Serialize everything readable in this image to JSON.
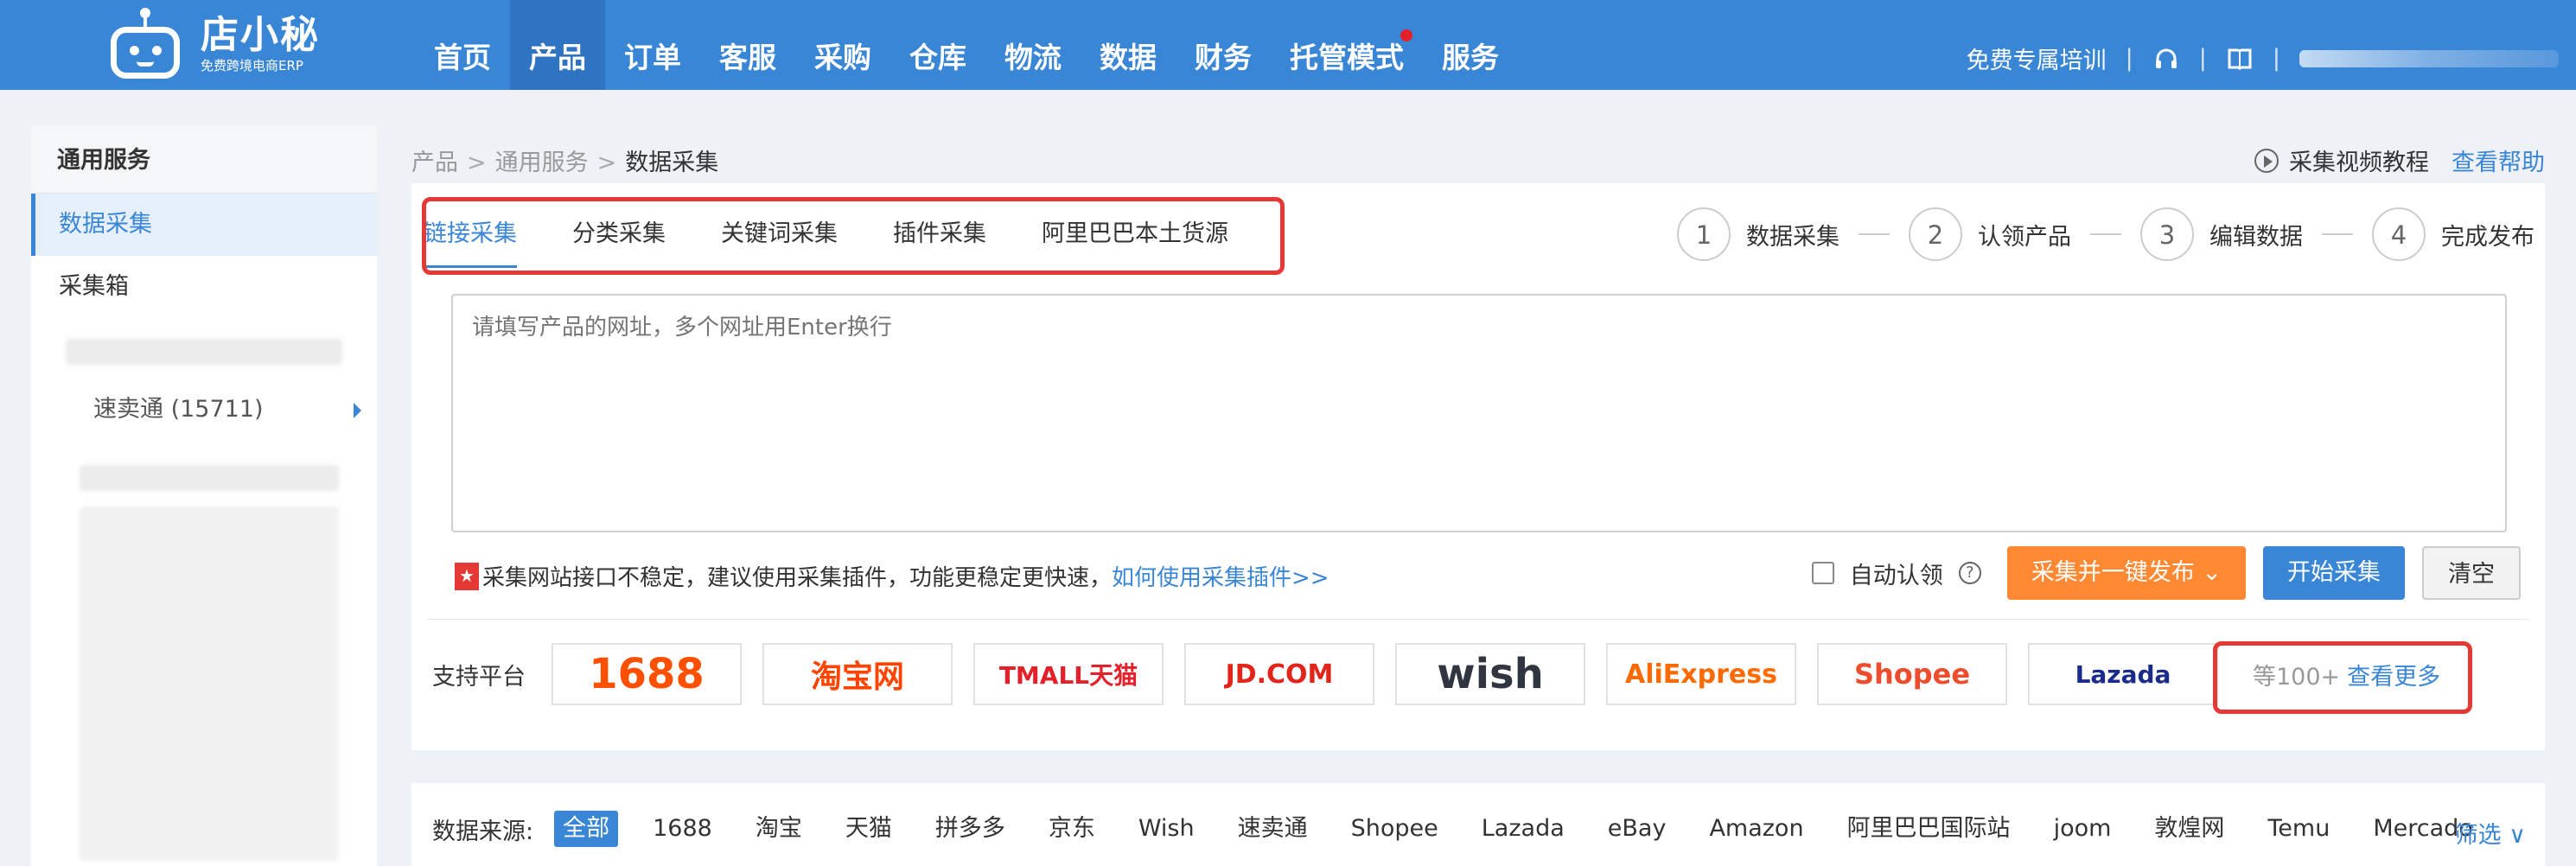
{
  "header": {
    "logo_name": "店小秘",
    "logo_sub": "免费跨境电商ERP",
    "nav": [
      {
        "label": "首页",
        "active": false,
        "dot": false
      },
      {
        "label": "产品",
        "active": true,
        "dot": false
      },
      {
        "label": "订单",
        "active": false,
        "dot": false
      },
      {
        "label": "客服",
        "active": false,
        "dot": false
      },
      {
        "label": "采购",
        "active": false,
        "dot": false
      },
      {
        "label": "仓库",
        "active": false,
        "dot": false
      },
      {
        "label": "物流",
        "active": false,
        "dot": false
      },
      {
        "label": "数据",
        "active": false,
        "dot": false
      },
      {
        "label": "财务",
        "active": false,
        "dot": false
      },
      {
        "label": "托管模式",
        "active": false,
        "dot": true
      },
      {
        "label": "服务",
        "active": false,
        "dot": false
      }
    ],
    "training": "免费专属培训",
    "separator": "|",
    "icons": [
      "headset-icon",
      "book-icon"
    ]
  },
  "sidebar": {
    "title": "通用服务",
    "items": [
      {
        "label": "数据采集",
        "active": true
      },
      {
        "label": "采集箱",
        "active": false
      }
    ],
    "sub_item": "速卖通 (15711)"
  },
  "breadcrumb": {
    "items": [
      "产品",
      "通用服务",
      "数据采集"
    ],
    "sep": ">"
  },
  "help": {
    "video": "采集视频教程",
    "link": "查看帮助"
  },
  "tabs": [
    {
      "label": "链接采集",
      "active": true
    },
    {
      "label": "分类采集",
      "active": false
    },
    {
      "label": "关键词采集",
      "active": false
    },
    {
      "label": "插件采集",
      "active": false
    },
    {
      "label": "阿里巴巴本土货源",
      "active": false
    }
  ],
  "steps": [
    {
      "num": "1",
      "label": "数据采集"
    },
    {
      "num": "2",
      "label": "认领产品"
    },
    {
      "num": "3",
      "label": "编辑数据"
    },
    {
      "num": "4",
      "label": "完成发布"
    }
  ],
  "url_input": {
    "placeholder": "请填写产品的网址，多个网址用Enter换行",
    "value": ""
  },
  "notice": {
    "flag": "★",
    "text": "采集网站接口不稳定，建议使用采集插件，功能更稳定更快速，",
    "link": "如何使用采集插件>>"
  },
  "ops": {
    "auto_claim": "自动认领",
    "help_q": "?",
    "publish_btn": "采集并一键发布",
    "start_btn": "开始采集",
    "clear_btn": "清空"
  },
  "platforms": {
    "label": "支持平台",
    "logos": [
      {
        "text": "1688",
        "color": "#ff5000"
      },
      {
        "text": "淘宝网",
        "color": "#ff4400"
      },
      {
        "text": "TMALL天猫",
        "color": "#e4202a"
      },
      {
        "text": "JD.COM",
        "color": "#e1251b"
      },
      {
        "text": "wish",
        "color": "#2f3640"
      },
      {
        "text": "AliExpress",
        "color": "#ff6a00"
      },
      {
        "text": "Shopee",
        "color": "#ee4d2d"
      },
      {
        "text": "Lazada",
        "color": "#1a2b8c"
      }
    ],
    "more_prefix": "等100+",
    "more_link": "查看更多"
  },
  "filter": {
    "label": "数据来源:",
    "chips": [
      "全部",
      "1688",
      "淘宝",
      "天猫",
      "拼多多",
      "京东",
      "Wish",
      "速卖通",
      "Shopee",
      "Lazada",
      "eBay",
      "Amazon",
      "阿里巴巴国际站",
      "joom",
      "敦煌网",
      "Temu",
      "Mercado"
    ],
    "active_index": 0,
    "filter_btn": "筛选 ∨"
  }
}
